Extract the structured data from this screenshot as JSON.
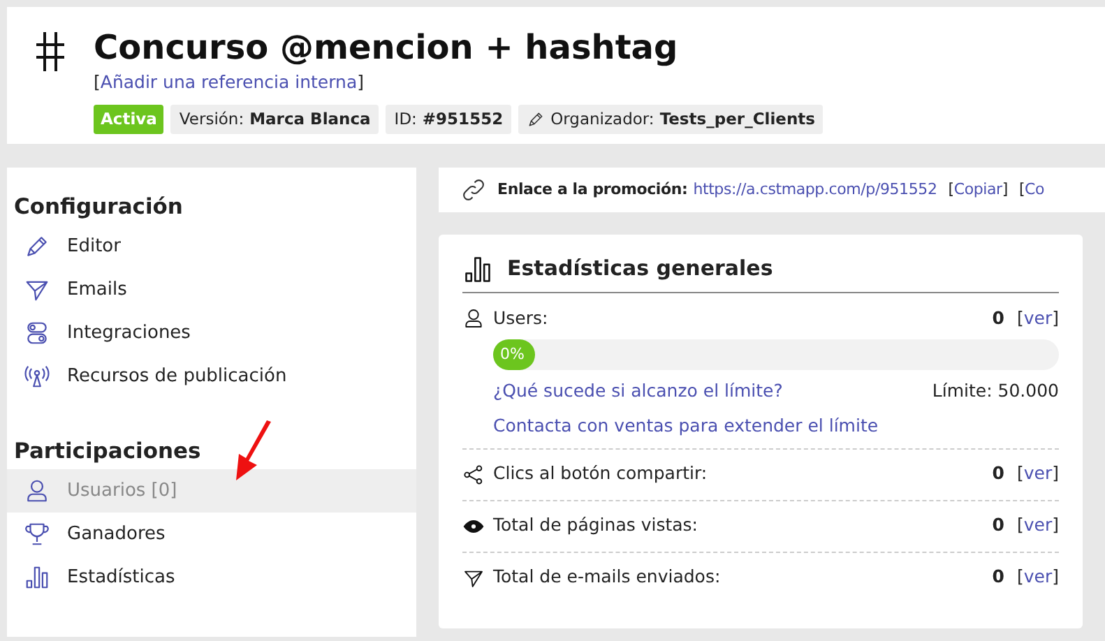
{
  "header": {
    "title": "Concurso @mencion + hashtag",
    "reference_link": {
      "open": "[",
      "text": "Añadir una referencia interna",
      "close": "]"
    },
    "badges": [
      {
        "kind": "status",
        "text": "Activa"
      },
      {
        "kind": "info",
        "label": "Versión:",
        "value": "Marca Blanca"
      },
      {
        "kind": "info",
        "label": "ID:",
        "value": "#951552"
      },
      {
        "kind": "organizer",
        "label": "Organizador:",
        "value": "Tests_per_Clients"
      }
    ]
  },
  "sidebar": {
    "sections": [
      {
        "title": "Configuración",
        "items": [
          {
            "kind": "pencil",
            "label": "Editor",
            "selected": false
          },
          {
            "kind": "send",
            "label": "Emails",
            "selected": false
          },
          {
            "kind": "toggles",
            "label": "Integraciones",
            "selected": false
          },
          {
            "kind": "antenna",
            "label": "Recursos de publicación",
            "selected": false
          }
        ]
      },
      {
        "title": "Participaciones",
        "items": [
          {
            "kind": "user",
            "label": "Usuarios [0]",
            "selected": true
          },
          {
            "kind": "trophy",
            "label": "Ganadores",
            "selected": false
          },
          {
            "kind": "bars",
            "label": "Estadísticas",
            "selected": false
          }
        ]
      }
    ]
  },
  "promo_link": {
    "label": "Enlace a la promoción:",
    "url": "https://a.cstmapp.com/p/951552",
    "actions": [
      {
        "open": "[",
        "text": "Copiar",
        "close": "]"
      },
      {
        "open": "[",
        "text": "Co"
      }
    ]
  },
  "stats": {
    "title": "Estadísticas generales",
    "rows": [
      {
        "kind": "user",
        "label": "Users:",
        "value": "0",
        "link": {
          "open": "[",
          "text": "ver",
          "close": "]"
        },
        "progress": {
          "level": 0,
          "text": "0%"
        },
        "help_link": "¿Qué sucede si alcanzo el límite?",
        "limit": "Límite: 50.000",
        "contact_link": "Contacta con ventas para extender el límite"
      },
      {
        "kind": "share",
        "label": "Clics al botón compartir:",
        "value": "0",
        "link": {
          "open": "[",
          "text": "ver",
          "close": "]"
        }
      },
      {
        "kind": "eye",
        "label": "Total de páginas vistas:",
        "value": "0",
        "link": {
          "open": "[",
          "text": "ver",
          "close": "]"
        }
      },
      {
        "kind": "send",
        "label": "Total de e-mails enviados:",
        "value": "0",
        "link": {
          "open": "[",
          "text": "ver",
          "close": "]"
        }
      }
    ]
  }
}
